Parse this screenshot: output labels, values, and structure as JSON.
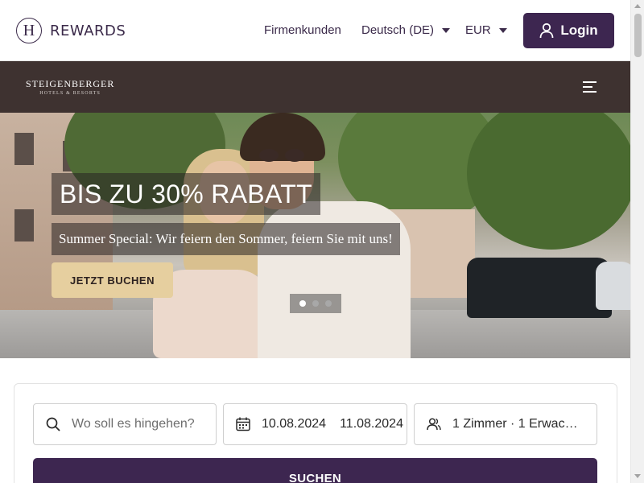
{
  "header": {
    "logo_letter": "H",
    "logo_text": "REWARDS",
    "corporate_link": "Firmenkunden",
    "language": "Deutsch (DE)",
    "currency": "EUR",
    "login_label": "Login"
  },
  "brand": {
    "name": "STEIGENBERGER",
    "tagline": "HOTELS & RESORTS"
  },
  "hero": {
    "headline": "BIS ZU 30% RABATT",
    "subline": "Summer Special: Wir feiern den Sommer, feiern Sie mit uns!",
    "cta_label": "JETZT BUCHEN",
    "slides_total": 3,
    "active_slide": 1
  },
  "search": {
    "destination_placeholder": "Wo soll es hingehen?",
    "checkin": "10.08.2024",
    "checkout": "11.08.2024",
    "rooms_guests": "1 Zimmer · 1 Erwac…",
    "submit_label": "SUCHEN"
  },
  "colors": {
    "primary": "#3d2650",
    "brand_bar": "#3e3230",
    "cta": "#e6cf9f"
  },
  "icons": {
    "login": "user-icon",
    "menu": "hamburger-menu-icon",
    "destination": "search-icon",
    "dates": "calendar-icon",
    "guests": "guests-icon"
  }
}
